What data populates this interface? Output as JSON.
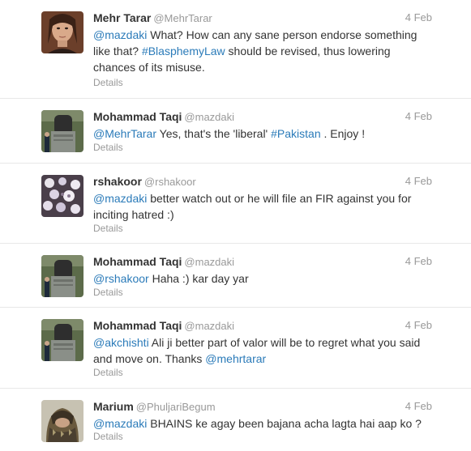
{
  "tweets": [
    {
      "name": "Mehr Tarar",
      "handle": "@MehrTarar",
      "time": "4 Feb",
      "details": "Details",
      "avatar_icon": "woman-portrait-avatar",
      "parts": [
        {
          "t": "mention",
          "v": "@mazdaki"
        },
        {
          "t": "text",
          "v": " What? How can any sane person endorse something like that? "
        },
        {
          "t": "hashtag",
          "v": "#BlasphemyLaw"
        },
        {
          "t": "text",
          "v": " should be revised, thus lowering chances of its misuse."
        }
      ]
    },
    {
      "name": "Mohammad Taqi",
      "handle": "@mazdaki",
      "time": "4 Feb",
      "details": "Details",
      "avatar_icon": "bust-monument-avatar",
      "parts": [
        {
          "t": "mention",
          "v": "@MehrTarar"
        },
        {
          "t": "text",
          "v": " Yes, that's the 'liberal' "
        },
        {
          "t": "hashtag",
          "v": "#Pakistan"
        },
        {
          "t": "text",
          "v": " . Enjoy !"
        }
      ]
    },
    {
      "name": "rshakoor",
      "handle": "@rshakoor",
      "time": "4 Feb",
      "details": "Details",
      "avatar_icon": "flowers-avatar",
      "parts": [
        {
          "t": "mention",
          "v": "@mazdaki"
        },
        {
          "t": "text",
          "v": " better watch out or he will file an FIR against you for inciting hatred :)"
        }
      ]
    },
    {
      "name": "Mohammad Taqi",
      "handle": "@mazdaki",
      "time": "4 Feb",
      "details": "Details",
      "avatar_icon": "bust-monument-avatar",
      "parts": [
        {
          "t": "mention",
          "v": "@rshakoor"
        },
        {
          "t": "text",
          "v": " Haha :) kar day yar"
        }
      ]
    },
    {
      "name": "Mohammad Taqi",
      "handle": "@mazdaki",
      "time": "4 Feb",
      "details": "Details",
      "avatar_icon": "bust-monument-avatar",
      "parts": [
        {
          "t": "mention",
          "v": "@akchishti"
        },
        {
          "t": "text",
          "v": " Ali ji better part of valor will be to regret what you said and move on. Thanks "
        },
        {
          "t": "mention",
          "v": "@mehrtarar"
        }
      ]
    },
    {
      "name": "Marium",
      "handle": "@PhuljariBegum",
      "time": "4 Feb",
      "details": "Details",
      "avatar_icon": "scarf-portrait-avatar",
      "parts": [
        {
          "t": "mention",
          "v": "@mazdaki"
        },
        {
          "t": "text",
          "v": " BHAINS ke agay been bajana acha lagta hai aap ko ?"
        }
      ]
    }
  ]
}
